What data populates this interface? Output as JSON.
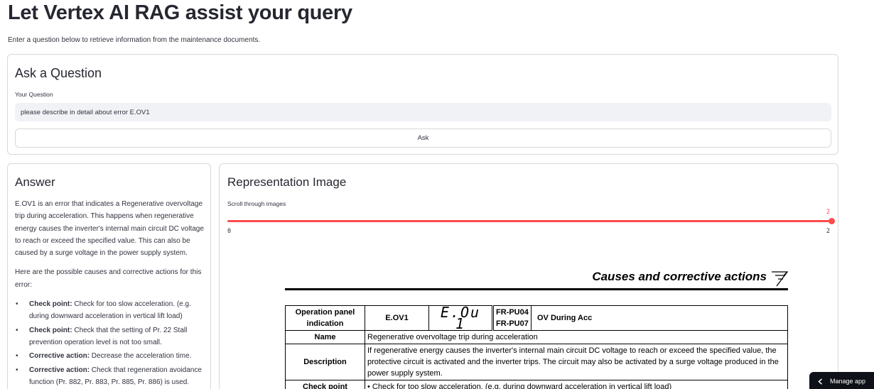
{
  "page": {
    "title": "Let Vertex AI RAG assist your query",
    "subtitle": "Enter a question below to retrieve information from the maintenance documents."
  },
  "ask": {
    "heading": "Ask a Question",
    "label": "Your Question",
    "value": "please describe in detail about error E.OV1",
    "button": "Ask"
  },
  "answer": {
    "heading": "Answer",
    "paragraph1": "E.OV1 is an error that indicates a Regenerative overvoltage trip during acceleration. This happens when regenerative energy causes the inverter's internal main circuit DC voltage to reach or exceed the specified value. This can also be caused by a surge voltage in the power supply system.",
    "paragraph2": "Here are the possible causes and corrective actions for this error:",
    "items": [
      {
        "label": "Check point:",
        "text": " Check for too slow acceleration. (e.g. during downward acceleration in vertical lift load)"
      },
      {
        "label": "Check point:",
        "text": " Check that the setting of Pr. 22 Stall prevention operation level is not too small."
      },
      {
        "label": "Corrective action:",
        "text": " Decrease the acceleration time."
      },
      {
        "label": "Corrective action:",
        "text": " Check that regeneration avoidance function (Pr. 882, Pr. 883, Pr. 885, Pr. 886) is used."
      }
    ]
  },
  "image": {
    "heading": "Representation Image",
    "slider_label": "Scroll through images",
    "slider_value": "2",
    "slider_min": "0",
    "slider_max": "2",
    "slider_fraction": 1.0,
    "accent_color": "#ff4b4b"
  },
  "doc": {
    "heading": "Causes and corrective actions",
    "op_label": "Operation panel indication",
    "code": "E.OV1",
    "segment": "E.Ou 1",
    "pu1": "FR-PU04",
    "pu2": "FR-PU07",
    "ov_name": "OV During Acc",
    "name_label": "Name",
    "name_value": "Regenerative overvoltage trip during acceleration",
    "desc_label": "Description",
    "desc_value": "If regenerative energy causes the inverter's internal main circuit DC voltage to reach or exceed the specified value, the protective circuit is activated and the inverter trips. The circuit may also be activated by a surge voltage produced in the power supply system.",
    "check_label": "Check point",
    "check_value": "•  Check for too slow acceleration. (e.g. during downward acceleration in vertical lift load)"
  },
  "manage": {
    "label": "Manage app",
    "icon": "chevron-left-icon"
  }
}
